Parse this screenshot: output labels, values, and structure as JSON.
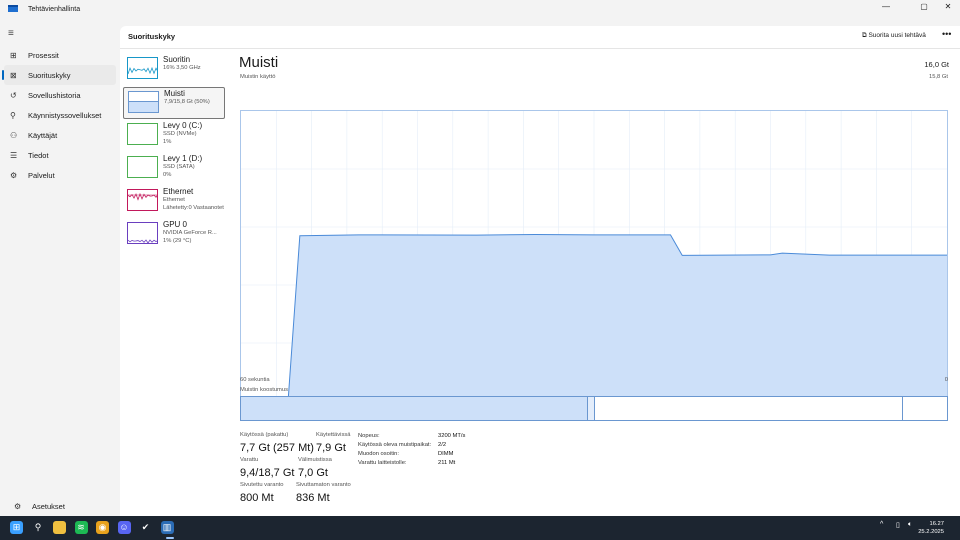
{
  "app": {
    "title": "Tehtävienhallinta",
    "minimize": "—",
    "maximize": "▢",
    "close": "✕"
  },
  "nav": {
    "menu_icon": "≡",
    "items": [
      {
        "label": "Prosessit",
        "icon": "processes-icon",
        "glyph": "⊞"
      },
      {
        "label": "Suorituskyky",
        "icon": "performance-icon",
        "glyph": "⊠",
        "active": true
      },
      {
        "label": "Sovellushistoria",
        "icon": "history-icon",
        "glyph": "↺"
      },
      {
        "label": "Käynnistyssovellukset",
        "icon": "startup-icon",
        "glyph": "⚲"
      },
      {
        "label": "Käyttäjät",
        "icon": "users-icon",
        "glyph": "⚇"
      },
      {
        "label": "Tiedot",
        "icon": "details-icon",
        "glyph": "☰"
      },
      {
        "label": "Palvelut",
        "icon": "services-icon",
        "glyph": "⚙"
      }
    ],
    "settings": {
      "label": "Asetukset",
      "glyph": "⚙"
    }
  },
  "header": {
    "title": "Suorituskyky",
    "run_task": "Suorita uusi tehtävä",
    "more": "•••"
  },
  "devices": [
    {
      "name": "Suoritin",
      "sub1": "16% 3,50 GHz",
      "color": "#1797c8"
    },
    {
      "name": "Muisti",
      "sub1": "7,9/15,8 Gt (50%)",
      "color": "#6a97d0",
      "selected": true
    },
    {
      "name": "Levy 0 (C:)",
      "sub1": "SSD (NVMe)",
      "sub2": "1%",
      "color": "#4caf50"
    },
    {
      "name": "Levy 1 (D:)",
      "sub1": "SSD (SATA)",
      "sub2": "0%",
      "color": "#4caf50"
    },
    {
      "name": "Ethernet",
      "sub1": "Ethernet",
      "sub2": "Lähetetty:0 Vastaanotet",
      "color": "#c2185b"
    },
    {
      "name": "GPU 0",
      "sub1": "NVIDIA GeForce R...",
      "sub2": "1% (29 °C)",
      "color": "#6a3fbf"
    }
  ],
  "memory": {
    "title": "Muisti",
    "total": "16,0 Gt",
    "usage_label": "Muistin käyttö",
    "max_label": "15,8 Gt",
    "time_left": "60 sekuntia",
    "time_right": "0",
    "composition_label": "Muistin koostumus",
    "fill_color": "#cde0f9",
    "line_color": "#4a8ad8",
    "usage_series_pct": [
      {
        "t": 60,
        "v": 0
      },
      {
        "t": 56,
        "v": 0
      },
      {
        "t": 55,
        "v": 57
      },
      {
        "t": 50,
        "v": 57.3
      },
      {
        "t": 40,
        "v": 57.2
      },
      {
        "t": 35,
        "v": 57.4
      },
      {
        "t": 30,
        "v": 57.3
      },
      {
        "t": 23.5,
        "v": 57.3
      },
      {
        "t": 22.5,
        "v": 50.2
      },
      {
        "t": 15,
        "v": 50.4
      },
      {
        "t": 14,
        "v": 51
      },
      {
        "t": 10,
        "v": 50.3
      },
      {
        "t": 0,
        "v": 50.3
      }
    ],
    "composition_pct": {
      "in_use": 49.1,
      "modified": 1,
      "standby": 43.6,
      "free": 6.3
    },
    "stats": [
      {
        "label": "Käytössä (pakattu)",
        "value": "7,7 Gt (257 Mt)"
      },
      {
        "label": "Käytettävissä",
        "value": "7,9 Gt"
      },
      {
        "label": "Varattu",
        "value": "9,4/18,7 Gt"
      },
      {
        "label": "Välimuistissa",
        "value": "7,0 Gt"
      },
      {
        "label": "Sivutettu varanto",
        "value": "800 Mt"
      },
      {
        "label": "Sivuttamaton varanto",
        "value": "836 Mt"
      }
    ],
    "props": [
      {
        "k": "Nopeus:",
        "v": "3200 MT/s"
      },
      {
        "k": "Käytössä oleva muistipaikat:",
        "v": "2/2"
      },
      {
        "k": "Muodon osoitin:",
        "v": "DIMM"
      },
      {
        "k": "Varattu laitteistolle:",
        "v": "211 Mt"
      }
    ]
  },
  "taskbar": {
    "time": "16.27",
    "date": "25.2.2025",
    "tray_chevron": "^",
    "apps": [
      {
        "icon": "start-icon",
        "c": "#3aa0ff",
        "g": "⊞"
      },
      {
        "icon": "search-icon",
        "c": "transparent",
        "g": "⚲"
      },
      {
        "icon": "file-explorer-icon",
        "c": "#f0c040",
        "g": ""
      },
      {
        "icon": "spotify-icon",
        "c": "#1db954",
        "g": "≋"
      },
      {
        "icon": "chrome-icon",
        "c": "#e8a21d",
        "g": "◉"
      },
      {
        "icon": "discord-icon",
        "c": "#5865f2",
        "g": "☺"
      },
      {
        "icon": "steam-icon",
        "c": "transparent",
        "g": "✔"
      },
      {
        "icon": "task-manager-icon",
        "c": "#2b6cb5",
        "g": "▥"
      }
    ]
  }
}
